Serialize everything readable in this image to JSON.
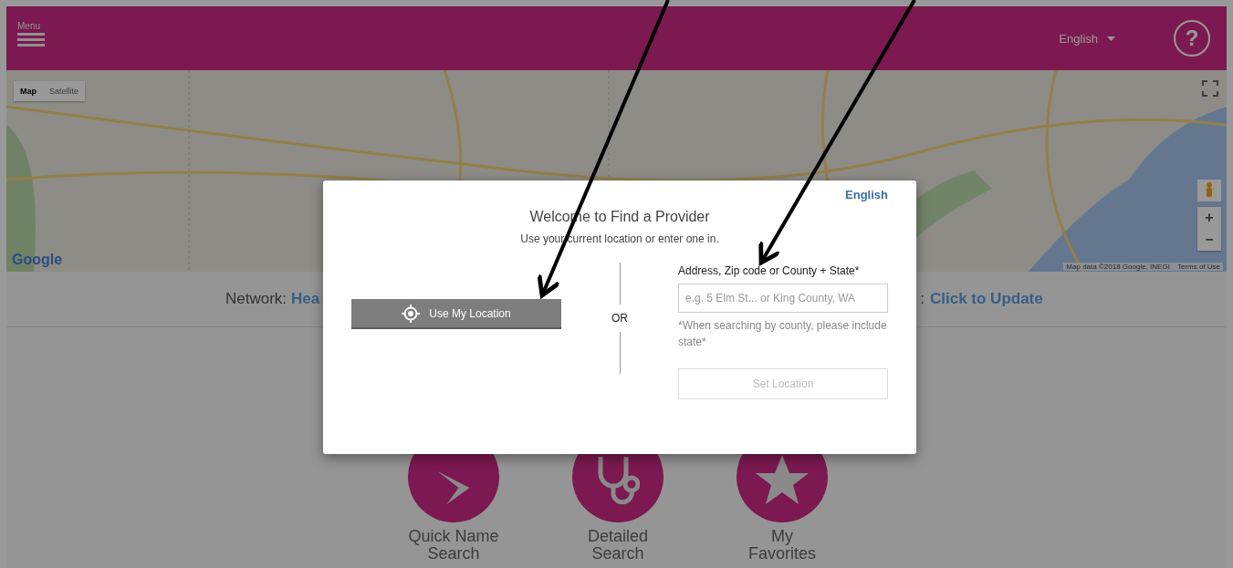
{
  "header": {
    "menu_label": "Menu",
    "language": "English",
    "help": "?"
  },
  "map": {
    "kind": "picture",
    "map_type_buttons": [
      {
        "label": "Map",
        "selected": true
      },
      {
        "label": "Satellite",
        "selected": false
      }
    ],
    "logo": "Google",
    "zoom_in": "+",
    "zoom_out": "−",
    "attribution": "Map data ©2018 Google, INEGI",
    "terms": "Terms of Use"
  },
  "network_bar": {
    "label": "Network:",
    "value": "Hea",
    "right_separator": ":",
    "update_link": "Click to Update"
  },
  "tiles": [
    {
      "kind": "quick",
      "label": "Quick Name\nSearch"
    },
    {
      "kind": "detailed",
      "label": "Detailed\nSearch"
    },
    {
      "kind": "favorites",
      "label": "My\nFavorites"
    }
  ],
  "dialog": {
    "language_link": "English",
    "title": "Welcome to Find a Provider",
    "subtitle": "Use your current location or enter one in.",
    "use_location_button": "Use My Location",
    "divider": "OR",
    "address_label": "Address, Zip code or County + State*",
    "address_placeholder": "e.g. 5 Elm St... or King County, WA",
    "hint": "*When searching by county, please include state*",
    "set_location_button": {
      "label": "Set Location",
      "disabled": true
    }
  }
}
